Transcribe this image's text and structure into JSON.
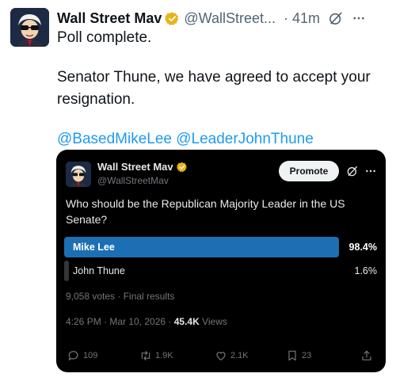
{
  "tweet": {
    "author_name": "Wall Street Mav",
    "author_handle": "@WallStreet...",
    "time": "· 41m",
    "lines": [
      "Poll complete.",
      "Senator Thune, we have agreed to accept your resignation."
    ],
    "mentions": "@BasedMikeLee @LeaderJohnThune"
  },
  "quote": {
    "author_name": "Wall Street Mav",
    "author_handle": "@WallStreetMav",
    "promote_label": "Promote",
    "question": "Who should be the Republican Majority Leader in the US Senate?",
    "poll_options": [
      {
        "label": "Mike Lee",
        "percent_text": "98.4%",
        "share": 0.984
      },
      {
        "label": "John Thune",
        "percent_text": "1.6%",
        "share": 0.016
      }
    ],
    "votes_text": "9,058 votes · Final results",
    "timestamp": "4:26 PM · Mar 10, 2026 · ",
    "views_count": "45.4K",
    "views_label": " Views",
    "actions": {
      "replies": "109",
      "retweets": "1.9K",
      "likes": "2.1K",
      "bookmarks": "23"
    }
  },
  "colors": {
    "accent": "#1d9bf0",
    "poll_winner": "#1d6fb3",
    "verified_gold": "#e8b41a"
  },
  "icons": [
    "verified-badge-icon",
    "grok-icon",
    "more-icon",
    "reply-icon",
    "retweet-icon",
    "like-icon",
    "bookmark-icon",
    "share-icon"
  ]
}
